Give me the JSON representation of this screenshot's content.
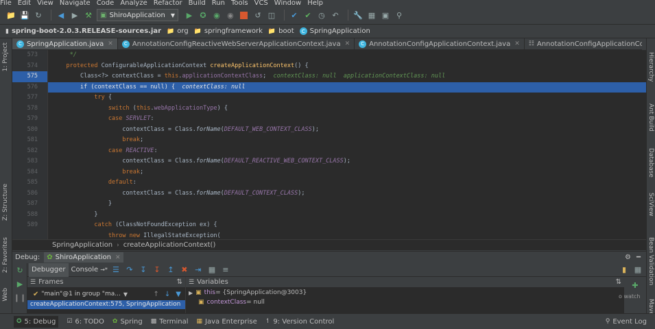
{
  "menu": [
    "File",
    "Edit",
    "View",
    "Navigate",
    "Code",
    "Analyze",
    "Refactor",
    "Build",
    "Run",
    "Tools",
    "VCS",
    "Window",
    "Help"
  ],
  "toolbar": {
    "run_config": "ShiroApplication"
  },
  "breadcrumb": [
    "spring-boot-2.0.3.RELEASE-sources.jar",
    "org",
    "springframework",
    "boot",
    "SpringApplication"
  ],
  "tabs": [
    "SpringApplication.java",
    "AnnotationConfigReactiveWebServerApplicationContext.java",
    "AnnotationConfigApplicationContext.java",
    "AnnotationConfigApplicationContext"
  ],
  "left_tools": [
    "1: Project",
    "Z: Structure",
    "2: Favorites",
    "Web"
  ],
  "right_tools": [
    "Hierarchy",
    "Ant Build",
    "Database",
    "SciView",
    "Bean Validation",
    "Maven"
  ],
  "line_numbers": [
    "573",
    "574",
    "575",
    "576",
    "577",
    "578",
    "579",
    "580",
    "581",
    "582",
    "583",
    "584",
    "585",
    "586",
    "587",
    "588",
    "589"
  ],
  "code": {
    "l574_kw": "protected ",
    "l574_type": "ConfigurableApplicationContext ",
    "l574_method": "createApplicationContext",
    "l574_rest": "() {",
    "l575_a": "Class<?> contextClass = ",
    "l575_kw": "this",
    "l575_b": ".",
    "l575_field": "applicationContextClass",
    "l575_c": ";",
    "l575_hint": "  contextClass: null  applicationContextClass: null",
    "l576_kw": "if ",
    "l576_a": "(contextClass == ",
    "l576_kw2": "null",
    "l576_b": ") {",
    "l576_hint": "  contextClass: null",
    "l577_kw": "try ",
    "l577_b": "{",
    "l578_kw": "switch ",
    "l578_a": "(",
    "l578_kw2": "this",
    "l578_b": ".",
    "l578_field": "webApplicationType",
    "l578_c": ") {",
    "l579_kw": "case ",
    "l579_const": "SERVLET",
    "l579_b": ":",
    "l580_a": "contextClass = Class.",
    "l580_m": "forName",
    "l580_b": "(",
    "l580_const": "DEFAULT_WEB_CONTEXT_CLASS",
    "l580_c": ");",
    "l581_kw": "break",
    "l581_b": ";",
    "l582_kw": "case ",
    "l582_const": "REACTIVE",
    "l582_b": ":",
    "l583_a": "contextClass = Class.",
    "l583_m": "forName",
    "l583_b": "(",
    "l583_const": "DEFAULT_REACTIVE_WEB_CONTEXT_CLASS",
    "l583_c": ");",
    "l584_kw": "break",
    "l584_b": ";",
    "l585_kw": "default",
    "l585_b": ":",
    "l586_a": "contextClass = Class.",
    "l586_m": "forName",
    "l586_b": "(",
    "l586_const": "DEFAULT_CONTEXT_CLASS",
    "l586_c": ");",
    "l587_b": "}",
    "l588_b": "}",
    "l589_kw": "catch ",
    "l589_a": "(ClassNotFoundException ex) {",
    "l590_kw": "throw new ",
    "l590_a": "IllegalStateException("
  },
  "editor_breadcrumb": [
    "SpringApplication",
    "createApplicationContext()"
  ],
  "debug": {
    "label": "Debug:",
    "config": "ShiroApplication",
    "tabs": [
      "Debugger",
      "Console"
    ],
    "frames_label": "Frames",
    "variables_label": "Variables",
    "thread": "\"main\"@1 in group \"ma...",
    "frame_row": "createApplicationContext:575, SpringApplication",
    "vars": [
      {
        "name": "this",
        "value": " = {SpringApplication@3003}"
      },
      {
        "name": "contextClass",
        "value": " = null"
      }
    ],
    "watch": "o watch"
  },
  "statusbar": {
    "items": [
      "5: Debug",
      "6: TODO",
      "Spring",
      "Terminal",
      "Java Enterprise",
      "9: Version Control"
    ],
    "event_log": "Event Log"
  }
}
